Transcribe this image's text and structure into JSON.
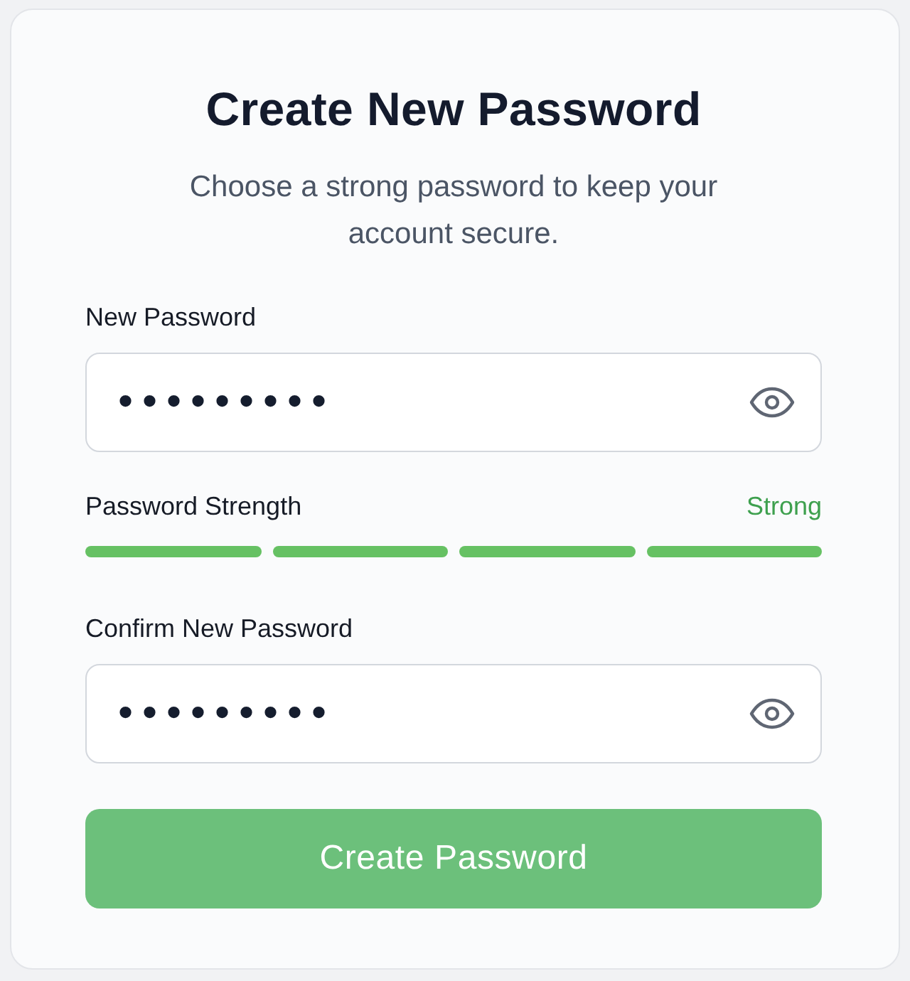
{
  "title": "Create New Password",
  "subtitle": "Choose a strong password to keep your account secure.",
  "new_password": {
    "label": "New Password",
    "value": "•••••••••"
  },
  "strength": {
    "label": "Password Strength",
    "reading": "Strong",
    "segments": [
      {
        "filled": true
      },
      {
        "filled": true
      },
      {
        "filled": true
      },
      {
        "filled": true
      }
    ]
  },
  "confirm_password": {
    "label": "Confirm New Password",
    "value": "•••••••••"
  },
  "submit_button": {
    "label": "Create Password"
  }
}
